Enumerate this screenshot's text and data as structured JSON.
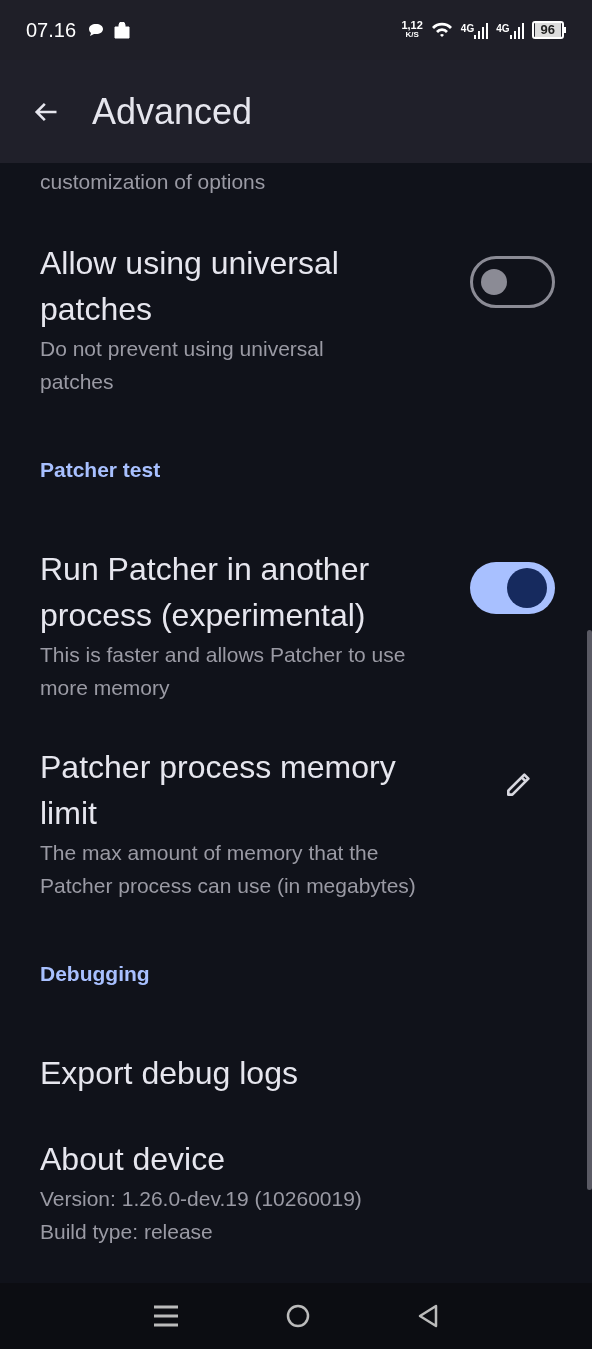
{
  "status_bar": {
    "time": "07.16",
    "net_speed": "1,12",
    "net_unit": "K/S",
    "signals": [
      "4G",
      "4G"
    ],
    "battery": "96"
  },
  "app_bar": {
    "title": "Advanced"
  },
  "items": [
    {
      "kind": "text",
      "description": "customization of options"
    },
    {
      "kind": "switch",
      "title": "Allow using universal patches",
      "description": "Do not prevent using universal patches",
      "on": false
    },
    {
      "kind": "header",
      "title": "Patcher test"
    },
    {
      "kind": "switch",
      "title": "Run Patcher in another process (experimental)",
      "description": "This is faster and allows Patcher to use more memory",
      "on": true
    },
    {
      "kind": "edit",
      "title": "Patcher process memory limit",
      "description": "The max amount of memory that the Patcher process can use (in megabytes)"
    },
    {
      "kind": "header",
      "title": "Debugging"
    },
    {
      "kind": "plain",
      "title": "Export debug logs"
    },
    {
      "kind": "info",
      "title": "About device",
      "lines": [
        "Version: 1.26.0-dev.19 (10260019)",
        "Build type: release"
      ]
    }
  ]
}
